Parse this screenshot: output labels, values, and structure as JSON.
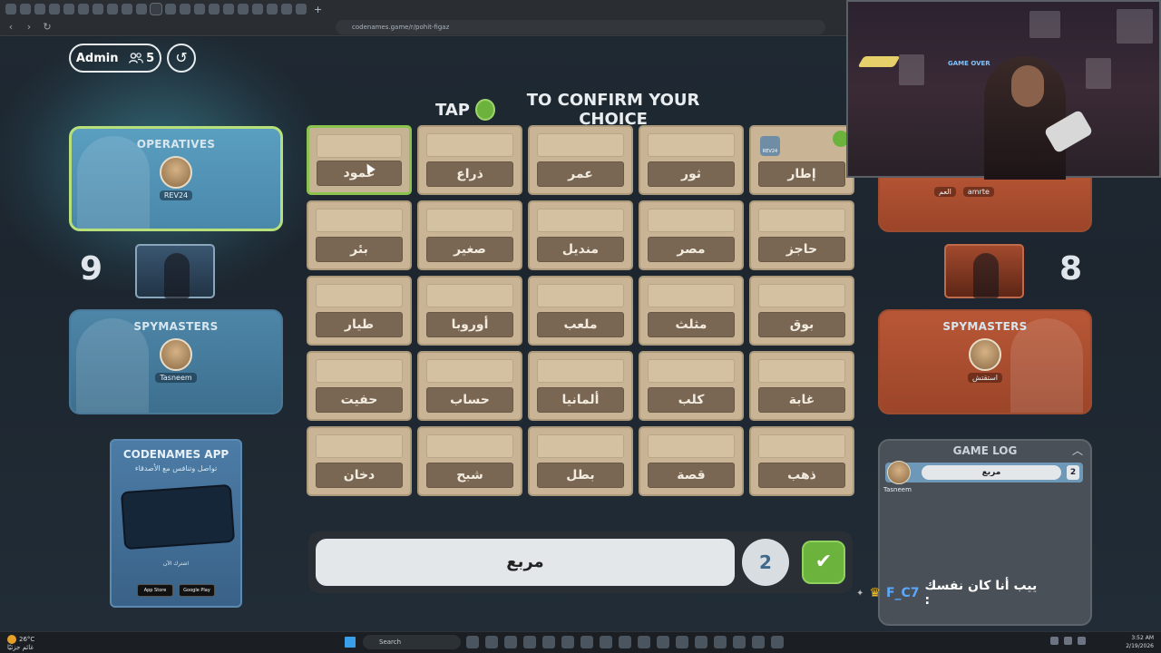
{
  "browser": {
    "url": "codenames.game/r/pohit-figaz",
    "new_tab_symbol": "+",
    "back": "‹",
    "forward": "›",
    "reload": "↻"
  },
  "header": {
    "admin_label": "Admin",
    "player_count": "5",
    "undo_icon": "refresh-icon"
  },
  "instruction": {
    "before": "TAP",
    "after": "TO CONFIRM YOUR CHOICE"
  },
  "blue_team": {
    "operatives_title": "OPERATIVES",
    "operative_name": "REV24",
    "cards_left": "9",
    "spymasters_title": "SPYMASTERS",
    "spymaster_name": "Tasneem",
    "color": "#4d86a8"
  },
  "red_team": {
    "operative_names": [
      "العم",
      "amrte"
    ],
    "cards_left": "8",
    "spymasters_title": "SPYMASTERS",
    "spymaster_name": "استقتش",
    "color": "#b85736"
  },
  "board": {
    "cards": [
      {
        "word": "عمود"
      },
      {
        "word": "ذراع"
      },
      {
        "word": "عمر"
      },
      {
        "word": "ثور"
      },
      {
        "word": "إطار"
      },
      {
        "word": "بئر"
      },
      {
        "word": "صغير"
      },
      {
        "word": "منديل"
      },
      {
        "word": "مصر"
      },
      {
        "word": "حاجز"
      },
      {
        "word": "طيار"
      },
      {
        "word": "أوروبا"
      },
      {
        "word": "ملعب"
      },
      {
        "word": "مثلث"
      },
      {
        "word": "بوق"
      },
      {
        "word": "حفيت"
      },
      {
        "word": "حساب"
      },
      {
        "word": "ألمانيا"
      },
      {
        "word": "كلب"
      },
      {
        "word": "غابة"
      },
      {
        "word": "دخان"
      },
      {
        "word": "شبح"
      },
      {
        "word": "بطل"
      },
      {
        "word": "قصة"
      },
      {
        "word": "ذهب"
      }
    ],
    "selected_index": 0,
    "marked_card_tag": "REV24"
  },
  "clue": {
    "word": "مربع",
    "number": "2",
    "confirm_symbol": "✔"
  },
  "promo": {
    "title": "CODENAMES APP",
    "subtitle": "تواصل وتنافس مع الأصدقاء",
    "cta": "اشترك الآن",
    "app_store": "App Store",
    "google_play": "Google Play"
  },
  "game_log": {
    "title": "GAME LOG",
    "entries": [
      {
        "player": "Tasneem",
        "word": "مربع",
        "number": "2"
      }
    ]
  },
  "webcam": {
    "sign_text": "GAME OVER"
  },
  "chat": {
    "user": "F_C7",
    "message": "ييب أنا كان نفسك :"
  },
  "taskbar": {
    "temperature": "26°C",
    "weather_desc": "غائم جزئيًا",
    "search_placeholder": "Search",
    "time": "3:52 AM",
    "date": "2/19/2026"
  }
}
